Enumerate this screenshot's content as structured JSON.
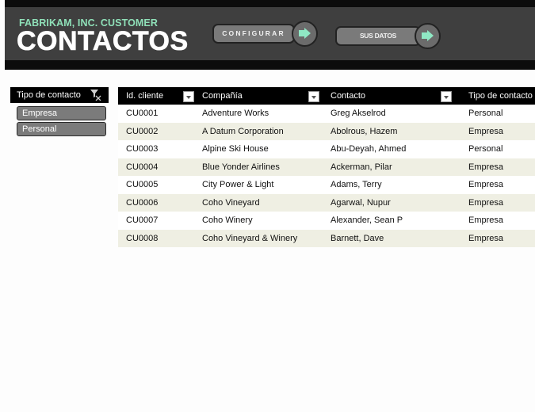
{
  "header": {
    "subtitle": "FABRIKAM, INC. CUSTOMER",
    "title": "CONTACTOS",
    "buttons": [
      {
        "label": "CONFIGURAR",
        "icon": "arrow-right-icon"
      },
      {
        "label": "SUS DATOS",
        "icon": "arrow-right-icon"
      }
    ],
    "accent_color": "#8fe0b8"
  },
  "slicer": {
    "title": "Tipo de contacto",
    "clear_icon": "clear-filter-icon",
    "items": [
      "Empresa",
      "Personal"
    ]
  },
  "table": {
    "columns": [
      "Id. cliente",
      "Compañía",
      "Contacto",
      "Tipo de contacto"
    ],
    "rows": [
      [
        "CU0001",
        "Adventure Works",
        "Greg Akselrod",
        "Personal"
      ],
      [
        "CU0002",
        "A Datum Corporation",
        "Abolrous, Hazem",
        "Empresa"
      ],
      [
        "CU0003",
        "Alpine Ski House",
        "Abu-Deyah, Ahmed",
        "Personal"
      ],
      [
        "CU0004",
        "Blue Yonder Airlines",
        "Ackerman, Pilar",
        "Empresa"
      ],
      [
        "CU0005",
        "City Power & Light",
        "Adams, Terry",
        "Empresa"
      ],
      [
        "CU0006",
        "Coho Vineyard",
        "Agarwal, Nupur",
        "Empresa"
      ],
      [
        "CU0007",
        "Coho Winery",
        "Alexander, Sean P",
        "Empresa"
      ],
      [
        "CU0008",
        "Coho Vineyard & Winery",
        "Barnett, Dave",
        "Empresa"
      ]
    ]
  }
}
